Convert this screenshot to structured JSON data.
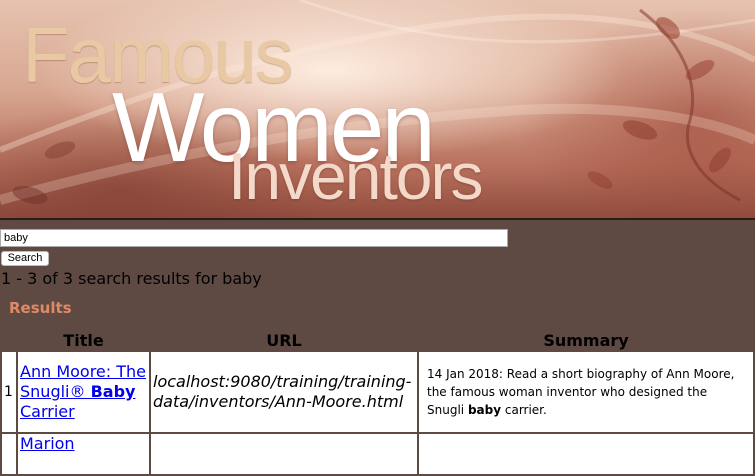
{
  "banner": {
    "line1": "Famous",
    "line2": "Women",
    "line3": "Inventors"
  },
  "search": {
    "query_value": "baby",
    "button_label": "Search"
  },
  "results_summary": "1 - 3 of 3 search results for baby",
  "results_heading": "Results",
  "table": {
    "headers": [
      "Title",
      "URL",
      "Summary"
    ],
    "rows": [
      {
        "num": "1",
        "title_pre": "Ann Moore: The Snugli® ",
        "title_bold": "Baby",
        "title_post": " Carrier",
        "url": "localhost:9080/training/training-data/inventors/Ann-Moore.html",
        "summary_pre": "14 Jan 2018: Read a short biography of Ann Moore, the famous woman inventor who designed the Snugli ",
        "summary_bold": "baby",
        "summary_post": " carrier."
      },
      {
        "num": "",
        "title_pre": "Marion",
        "title_bold": "",
        "title_post": "",
        "url": "",
        "summary_pre": "",
        "summary_bold": "",
        "summary_post": ""
      }
    ]
  },
  "colors": {
    "page_background": "#5e4a43",
    "results_heading": "#e08a64",
    "link": "#0000ee"
  }
}
